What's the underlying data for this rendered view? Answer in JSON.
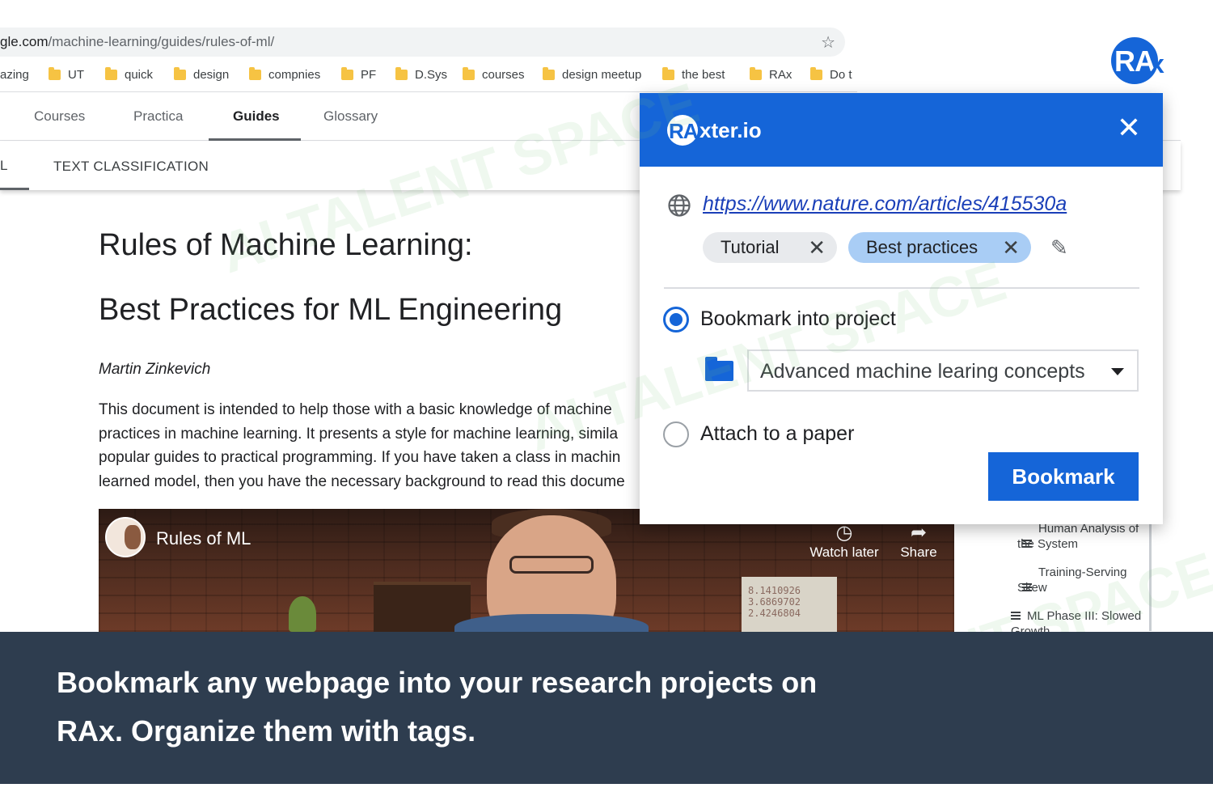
{
  "browser": {
    "url_domain": "gle.com",
    "url_path": "/machine-learning/guides/rules-of-ml/",
    "bookmarks": [
      "azing",
      "UT",
      "quick",
      "design",
      "compnies",
      "PF",
      "D.Sys",
      "courses",
      "design meetup",
      "the best",
      "RAx",
      "Do t"
    ]
  },
  "site": {
    "tabs": [
      "Courses",
      "Practica",
      "Guides",
      "Glossary"
    ],
    "subtab_left": "L",
    "subtab": "TEXT CLASSIFICATION",
    "title_line1": "Rules of Machine Learning:",
    "title_line2": "Best Practices for ML Engineering",
    "author": "Martin Zinkevich",
    "paragraph": [
      "This document is intended to help those with a basic knowledge of machine",
      "practices in machine learning. It presents a style for machine learning, simila",
      "popular guides to practical programming. If you have taken a class in machin",
      "learned model, then you have the necessary background to read this docume"
    ],
    "video": {
      "title": "Rules of ML",
      "watch_later": "Watch later",
      "share": "Share",
      "board_text": "8.1410926\n3.6869702\n2.4246804"
    },
    "toc": [
      "Human Analysis of the System",
      "Training-Serving Skew",
      "ML Phase III: Slowed Growth"
    ]
  },
  "logo": {
    "text": "RA",
    "x": "x"
  },
  "popup": {
    "brand_badge": "RA",
    "brand_name": "xter.io",
    "url": "https://www.nature.com/articles/415530a",
    "tags": [
      "Tutorial",
      "Best practices"
    ],
    "option_project": "Bookmark into project",
    "project_selected": "Advanced machine learing concepts",
    "option_paper": "Attach to a paper",
    "submit": "Bookmark",
    "selected_option": "project"
  },
  "caption": {
    "line1": "Bookmark any webpage into your research projects on",
    "line2": "RAx. Organize them with tags."
  },
  "watermark": "AI TALENT SPACE",
  "colors": {
    "accent": "#1565d8",
    "caption_bg": "#2e3d4f",
    "tag_selected": "#a9cdf5"
  }
}
